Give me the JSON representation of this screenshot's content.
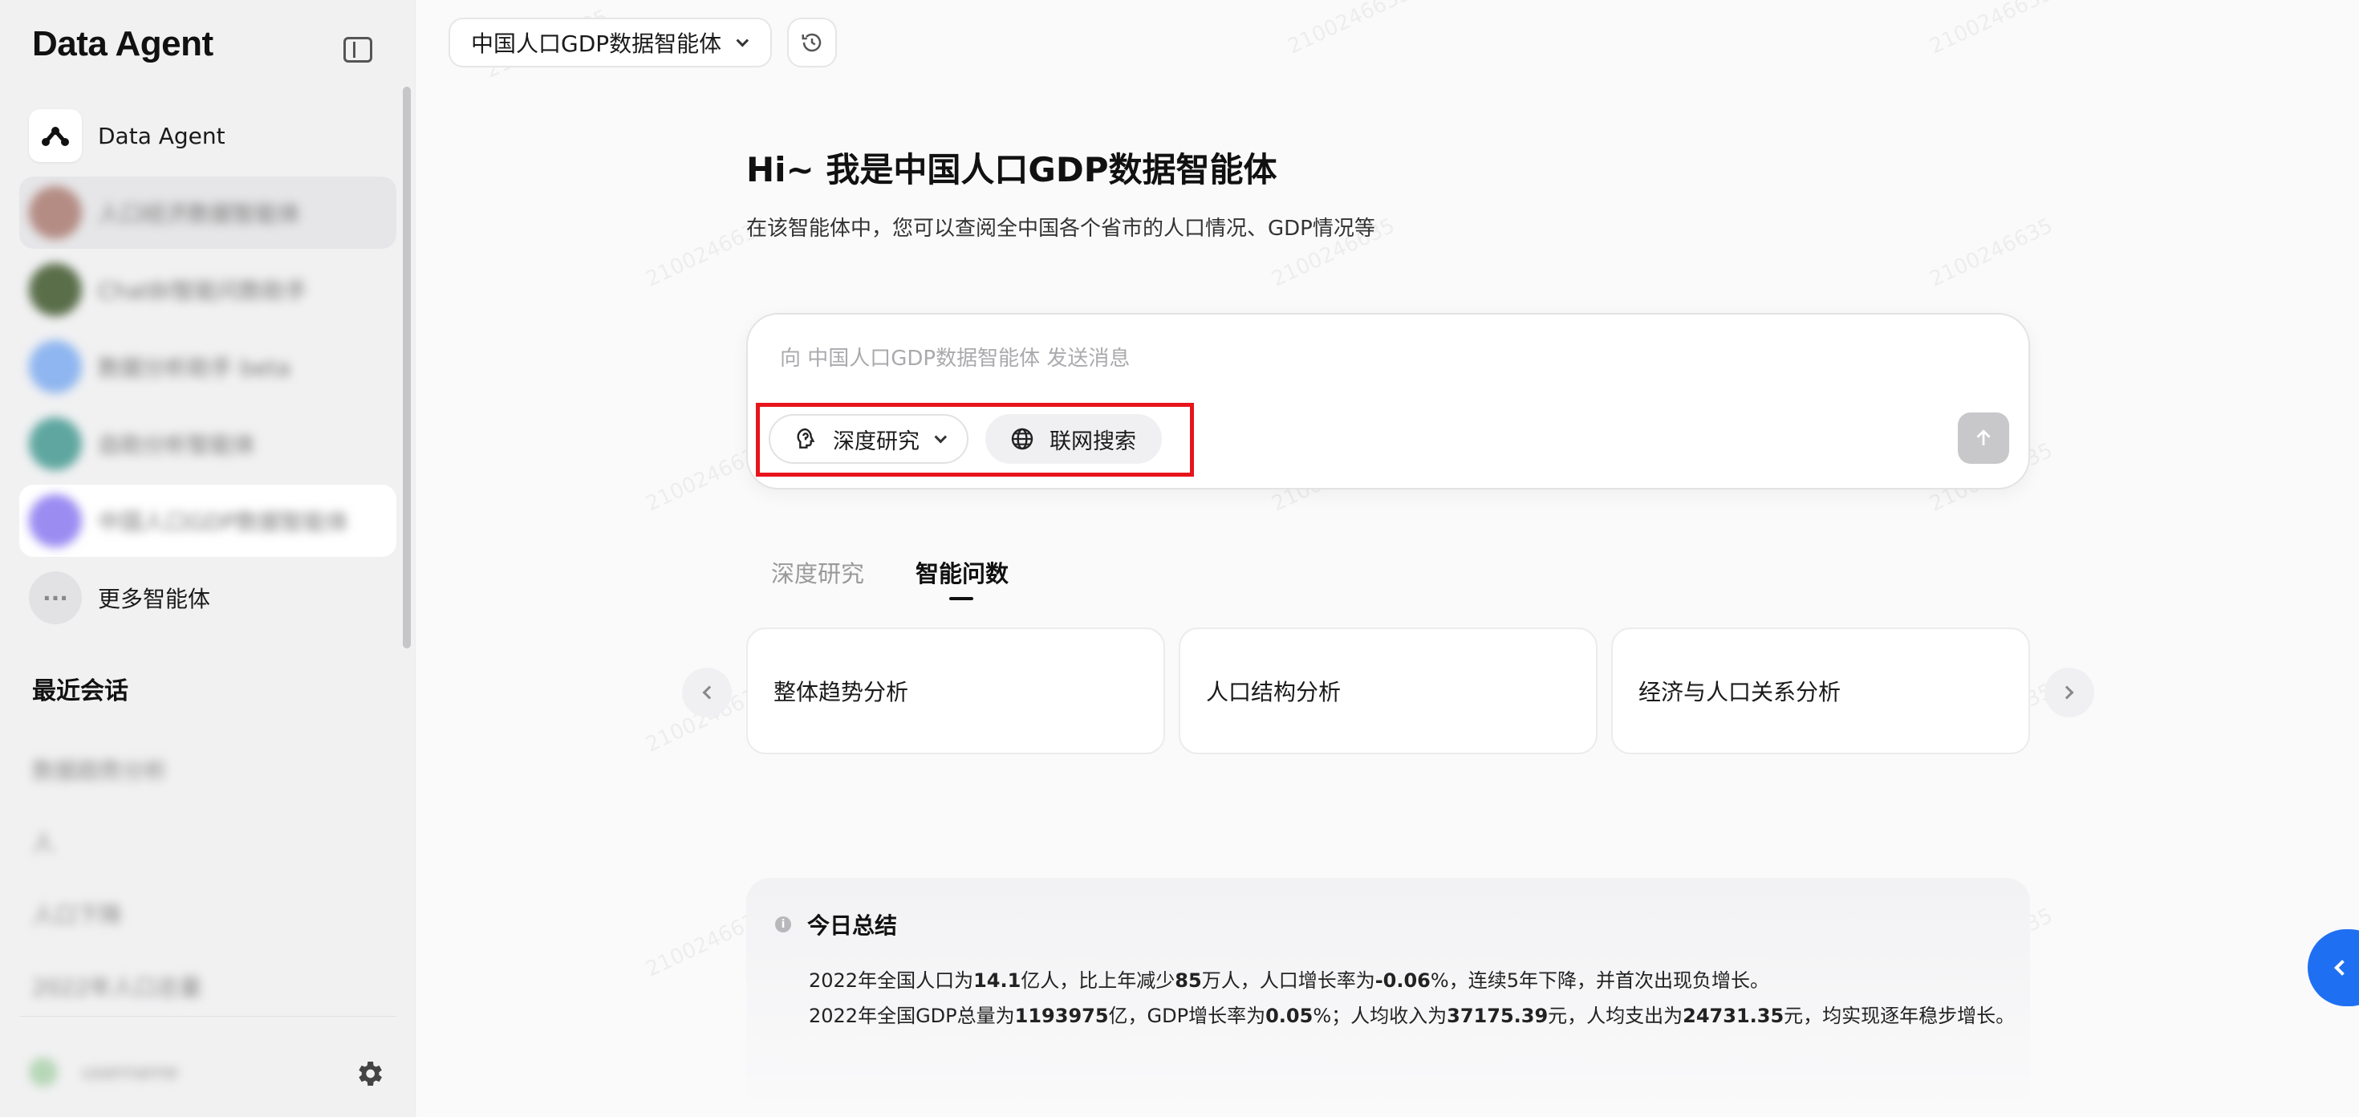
{
  "sidebar": {
    "brand": "Data Agent",
    "agents": [
      {
        "label": "Data Agent",
        "blurred": false
      },
      {
        "label": "人口经济数据智能体",
        "blurred": true
      },
      {
        "label": "ChatBI智能问数助手",
        "blurred": true
      },
      {
        "label": "数据分析助手 beta",
        "blurred": true
      },
      {
        "label": "自助分析智能体",
        "blurred": true
      },
      {
        "label": "中国人口GDP数据智能体",
        "blurred": true
      }
    ],
    "more_label": "更多智能体",
    "more_icon": "···",
    "recent_title": "最近会话",
    "recent_items": [
      "数据趋势分析",
      "人",
      "人口下降",
      "2022年人口总量"
    ],
    "user_name": "username"
  },
  "header": {
    "agent_selector": "中国人口GDP数据智能体"
  },
  "hero": {
    "title": "Hi~ 我是中国人口GDP数据智能体",
    "subtitle": "在该智能体中，您可以查阅全中国各个省市的人口情况、GDP情况等"
  },
  "composer": {
    "placeholder": "向 中国人口GDP数据智能体 发送消息",
    "value": "",
    "deep_research_label": "深度研究",
    "web_search_label": "联网搜索"
  },
  "tabs": [
    {
      "label": "深度研究",
      "active": false
    },
    {
      "label": "智能问数",
      "active": true
    }
  ],
  "cards": [
    "整体趋势分析",
    "人口结构分析",
    "经济与人口关系分析"
  ],
  "summary": {
    "icon": "i",
    "title": "今日总结",
    "line1": {
      "t1": "2022年全国人口为",
      "v1": "14.1",
      "t2": "亿人，比上年减少",
      "v2": "85",
      "t3": "万人，人口增长率为",
      "v3": "-0.06",
      "t4": "%，连续5年下降，并首次出现负增长。"
    },
    "line2": {
      "t1": "2022年全国GDP总量为",
      "v1": "1193975",
      "t2": "亿，GDP增长率为",
      "v2": "0.05",
      "t3": "%；人均收入为",
      "v3": "37175.39",
      "t4": "元，人均支出为",
      "v4": "24731.35",
      "t5": "元，均实现逐年稳步增长。"
    }
  },
  "watermark": "2100246635",
  "colors": {
    "accent": "#1f6ff2",
    "highlight": "#e8141c"
  }
}
